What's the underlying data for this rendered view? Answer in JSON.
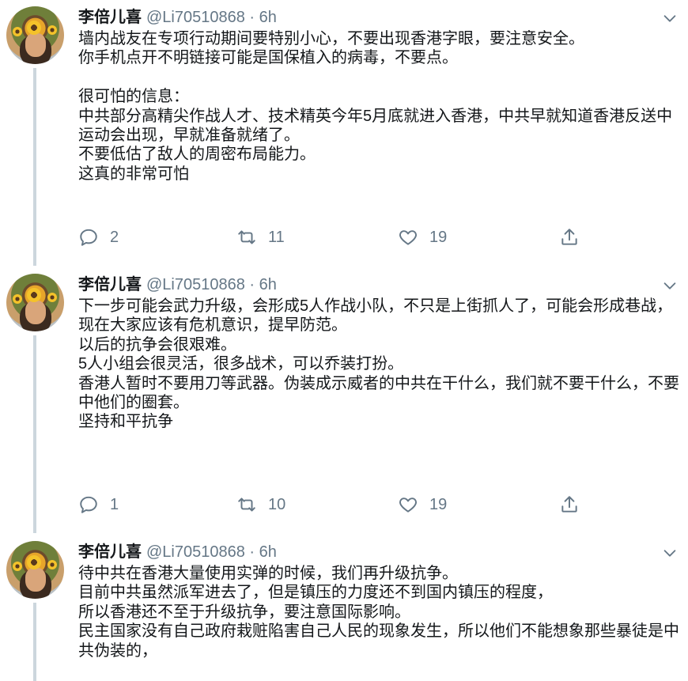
{
  "tweets": [
    {
      "author_name": "李倍儿喜",
      "handle_time": "@Li70510868 · 6h",
      "text": "墙内战友在专项行动期间要特别小心，不要出现香港字眼，要注意安全。\n你手机点开不明链接可能是国保植入的病毒，不要点。\n\n很可怕的信息：\n中共部分高精尖作战人才、技术精英今年5月底就进入香港，中共早就知道香港反送中运动会出现，早就准备就绪了。\n不要低估了敌人的周密布局能力。\n这真的非常可怕",
      "replies": "2",
      "retweets": "11",
      "likes": "19"
    },
    {
      "author_name": "李倍儿喜",
      "handle_time": "@Li70510868 · 6h",
      "text": "下一步可能会武力升级，会形成5人作战小队，不只是上街抓人了，可能会形成巷战，\n现在大家应该有危机意识，提早防范。\n以后的抗争会很艰难。\n5人小组会很灵活，很多战术，可以乔装打扮。\n香港人暂时不要用刀等武器。伪装成示威者的中共在干什么，我们就不要干什么，不要中他们的圈套。\n坚持和平抗争",
      "replies": "1",
      "retweets": "10",
      "likes": "19"
    },
    {
      "author_name": "李倍儿喜",
      "handle_time": "@Li70510868 · 6h",
      "text": "待中共在香港大量使用实弹的时候，我们再升级抗争。\n目前中共虽然派军进去了，但是镇压的力度还不到国内镇压的程度，\n所以香港还不至于升级抗争，要注意国际影响。\n民主国家没有自己政府栽赃陷害自己人民的现象发生，所以他们不能想象那些暴徒是中共伪装的，",
      "replies": "",
      "retweets": "",
      "likes": ""
    }
  ],
  "icons": {
    "reply": "reply-icon",
    "retweet": "retweet-icon",
    "like": "heart-icon",
    "share": "share-icon",
    "more": "chevron-down-icon"
  },
  "colors": {
    "text": "#14171a",
    "secondary": "#657786",
    "thread_line": "#ccd6dd"
  }
}
